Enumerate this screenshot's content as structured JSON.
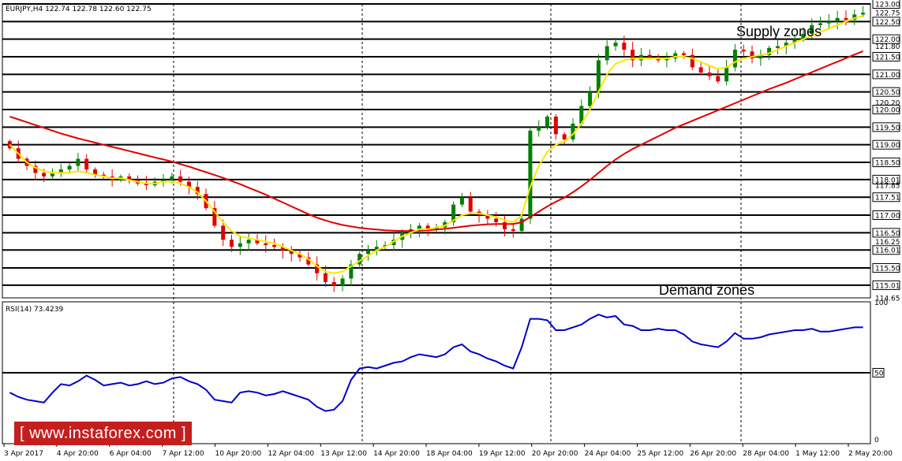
{
  "header": {
    "symbol_info": "EURJPY,H4  122.74 122.78 122.60 122.75"
  },
  "annotations": {
    "supply": "Supply zones",
    "demand": "Demand zones"
  },
  "rsi_panel": {
    "label": "RSI(14) 73.4239",
    "level_100": "100",
    "level_50": "50",
    "level_0": "0"
  },
  "watermark": "[ www.instaforex.com ]",
  "colors": {
    "up_candle": "#008000",
    "down_candle": "#e00000",
    "ma_fast": "#ffe600",
    "ma_slow": "#e00000",
    "rsi": "#0000c8",
    "watermark_bg": "#c41e1e"
  },
  "chart_data": [
    {
      "type": "candlestick",
      "title": "EURJPY,H4",
      "ohlc_last": {
        "open": 122.74,
        "high": 122.78,
        "low": 122.6,
        "close": 122.75
      },
      "ylim": [
        114.65,
        123.0
      ],
      "y_tick_labels": [
        "123.00",
        "122.75",
        "122.50",
        "122.00",
        "121.80",
        "121.50",
        "121.00",
        "120.50",
        "120.20",
        "120.00",
        "119.50",
        "119.00",
        "118.50",
        "118.01",
        "117.85",
        "117.51",
        "117.00",
        "116.50",
        "116.25",
        "116.01",
        "115.50",
        "115.01",
        "114.65"
      ],
      "horizontal_levels": [
        123.0,
        122.5,
        122.0,
        121.5,
        121.0,
        120.5,
        120.0,
        119.5,
        119.0,
        118.5,
        118.01,
        117.51,
        117.0,
        116.5,
        116.01,
        115.5,
        115.01
      ],
      "x_tick_labels": [
        "3 Apr 2017",
        "4 Apr 20:00",
        "6 Apr 04:00",
        "7 Apr 12:00",
        "10 Apr 20:00",
        "12 Apr 04:00",
        "13 Apr 12:00",
        "14 Apr 20:00",
        "18 Apr 04:00",
        "19 Apr 12:00",
        "20 Apr 20:00",
        "24 Apr 04:00",
        "25 Apr 12:00",
        "26 Apr 20:00",
        "28 Apr 04:00",
        "1 May 12:00",
        "2 May 20:00"
      ],
      "close_path": [
        118.9,
        118.6,
        118.4,
        118.2,
        118.1,
        118.2,
        118.3,
        118.4,
        118.6,
        118.3,
        118.15,
        118.1,
        118.0,
        118.1,
        118.0,
        117.9,
        117.85,
        117.95,
        118.0,
        118.1,
        117.95,
        117.8,
        117.6,
        117.2,
        116.7,
        116.3,
        116.1,
        116.2,
        116.3,
        116.2,
        116.15,
        116.1,
        116.0,
        115.9,
        115.8,
        115.6,
        115.35,
        115.1,
        115.0,
        115.2,
        115.6,
        115.9,
        116.0,
        116.1,
        116.15,
        116.3,
        116.5,
        116.6,
        116.7,
        116.6,
        116.65,
        116.8,
        117.3,
        117.5,
        117.1,
        117.0,
        116.9,
        116.8,
        116.6,
        116.55,
        116.9,
        119.4,
        119.5,
        119.8,
        119.3,
        119.15,
        119.6,
        120.1,
        120.5,
        121.4,
        121.8,
        121.9,
        121.7,
        121.4,
        121.55,
        121.5,
        121.4,
        121.45,
        121.6,
        121.55,
        121.2,
        121.05,
        120.95,
        120.8,
        121.2,
        121.7,
        121.65,
        121.45,
        121.55,
        121.75,
        121.8,
        121.9,
        122.0,
        122.15,
        122.4,
        122.45,
        122.5,
        122.6,
        122.55,
        122.7,
        122.75
      ],
      "ma_fast_path": [
        119.0,
        118.75,
        118.5,
        118.35,
        118.25,
        118.2,
        118.2,
        118.2,
        118.25,
        118.2,
        118.15,
        118.1,
        118.05,
        118.05,
        118.0,
        117.95,
        117.9,
        117.9,
        117.95,
        117.95,
        117.9,
        117.8,
        117.65,
        117.4,
        117.1,
        116.8,
        116.55,
        116.4,
        116.35,
        116.3,
        116.25,
        116.2,
        116.1,
        116.0,
        115.9,
        115.75,
        115.55,
        115.4,
        115.35,
        115.4,
        115.55,
        115.7,
        115.85,
        116.0,
        116.1,
        116.25,
        116.4,
        116.5,
        116.6,
        116.6,
        116.65,
        116.7,
        116.85,
        117.0,
        117.05,
        117.05,
        117.0,
        116.95,
        116.85,
        116.8,
        117.0,
        117.8,
        118.4,
        118.8,
        119.0,
        119.1,
        119.3,
        119.6,
        120.0,
        120.5,
        121.0,
        121.3,
        121.4,
        121.45,
        121.45,
        121.45,
        121.45,
        121.45,
        121.5,
        121.5,
        121.45,
        121.35,
        121.25,
        121.15,
        121.2,
        121.35,
        121.45,
        121.5,
        121.55,
        121.6,
        121.7,
        121.8,
        121.9,
        122.0,
        122.1,
        122.2,
        122.3,
        122.4,
        122.5,
        122.6,
        122.65
      ],
      "ma_slow_path": [
        119.8,
        119.72,
        119.64,
        119.56,
        119.48,
        119.4,
        119.32,
        119.25,
        119.18,
        119.12,
        119.06,
        119.0,
        118.94,
        118.88,
        118.82,
        118.76,
        118.7,
        118.64,
        118.58,
        118.52,
        118.45,
        118.38,
        118.3,
        118.22,
        118.14,
        118.06,
        117.97,
        117.88,
        117.78,
        117.68,
        117.58,
        117.47,
        117.36,
        117.25,
        117.14,
        117.03,
        116.93,
        116.85,
        116.78,
        116.72,
        116.68,
        116.64,
        116.61,
        116.59,
        116.57,
        116.56,
        116.55,
        116.55,
        116.56,
        116.57,
        116.59,
        116.61,
        116.64,
        116.67,
        116.7,
        116.72,
        116.74,
        116.75,
        116.75,
        116.75,
        116.8,
        116.95,
        117.1,
        117.25,
        117.38,
        117.5,
        117.65,
        117.82,
        118.0,
        118.2,
        118.4,
        118.58,
        118.74,
        118.88,
        119.0,
        119.12,
        119.24,
        119.36,
        119.48,
        119.58,
        119.68,
        119.78,
        119.88,
        119.98,
        120.08,
        120.18,
        120.28,
        120.38,
        120.48,
        120.58,
        120.67,
        120.76,
        120.86,
        120.96,
        121.06,
        121.16,
        121.26,
        121.36,
        121.46,
        121.56,
        121.66
      ]
    },
    {
      "type": "line",
      "title": "RSI(14) 73.4239",
      "ylim": [
        0,
        100
      ],
      "y_tick_labels": [
        "100",
        "50",
        "0"
      ],
      "reference_level": 50,
      "last_value": 73.4239,
      "series": [
        {
          "values": [
            36,
            33,
            31,
            30,
            29,
            36,
            42,
            41,
            44,
            48,
            45,
            41,
            42,
            43,
            41,
            42,
            44,
            42,
            43,
            46,
            47,
            44,
            42,
            38,
            31,
            30,
            29,
            36,
            37,
            36,
            34,
            35,
            37,
            35,
            33,
            31,
            26,
            23,
            24,
            30,
            45,
            53,
            54,
            53,
            55,
            57,
            58,
            61,
            63,
            62,
            61,
            63,
            68,
            70,
            65,
            63,
            60,
            58,
            55,
            53,
            68,
            88,
            88,
            87,
            80,
            80,
            82,
            84,
            88,
            91,
            89,
            90,
            84,
            83,
            80,
            80,
            81,
            80,
            80,
            77,
            72,
            70,
            69,
            68,
            72,
            78,
            74,
            74,
            75,
            77,
            78,
            79,
            80,
            80,
            81,
            79,
            79,
            80,
            81,
            82,
            82
          ]
        }
      ]
    }
  ]
}
